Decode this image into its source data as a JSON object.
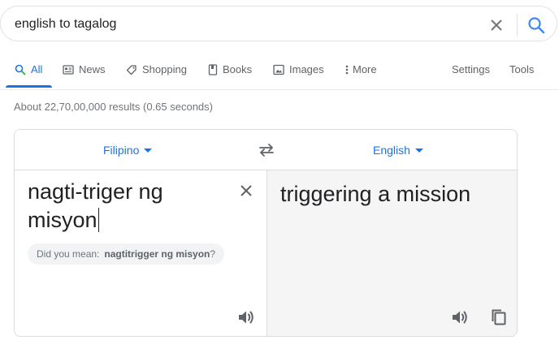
{
  "search": {
    "query": "english to tagalog"
  },
  "tabs": [
    {
      "label": "All",
      "icon": "search-icon"
    },
    {
      "label": "News",
      "icon": "newspaper-icon"
    },
    {
      "label": "Shopping",
      "icon": "tag-icon"
    },
    {
      "label": "Books",
      "icon": "book-icon"
    },
    {
      "label": "Images",
      "icon": "image-icon"
    },
    {
      "label": "More",
      "icon": "more-vert-icon"
    }
  ],
  "tools": {
    "settings": "Settings",
    "tools": "Tools"
  },
  "stats": "About 22,70,00,000 results (0.65 seconds)",
  "translate": {
    "source_lang": "Filipino",
    "target_lang": "English",
    "source_text_line1": "nagti-triger ng",
    "source_text_line2": "misyon",
    "target_text": "triggering a mission",
    "did_you_mean_prefix": "Did you mean:",
    "did_you_mean_suggestion": "nagtitrigger ng misyon",
    "did_you_mean_suffix": "?"
  },
  "colors": {
    "accent": "#1a73e8",
    "muted": "#70757a",
    "target_pane_bg": "#f5f5f5"
  }
}
